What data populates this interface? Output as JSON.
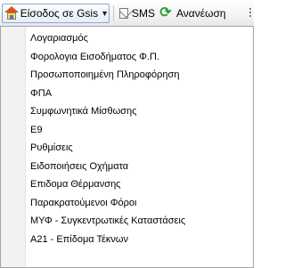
{
  "toolbar": {
    "gsis_label": "Είσοδος σε Gsis",
    "sms_label": "SMS",
    "refresh_label": "Ανανέωση"
  },
  "menu": {
    "items": [
      {
        "label": "Λογαριασμός"
      },
      {
        "label": "Φορολογια Εισοδήματος Φ.Π."
      },
      {
        "label": "Προσωποποιημένη Πληροφόρηση"
      },
      {
        "label": "ΦΠΑ"
      },
      {
        "label": "Συμφωνητικά Μίσθωσης"
      },
      {
        "label": "Ε9"
      },
      {
        "label": "Ρυθμίσεις"
      },
      {
        "label": "Ειδοποιήσεις  Οχήματα"
      },
      {
        "label": "Επιδομα Θέρμανσης"
      },
      {
        "label": "Παρακρατούμενοι Φόροι"
      },
      {
        "label": "ΜΥΦ - Συγκεντρωτικές Καταστάσεις"
      },
      {
        "label": "Α21 - Επίδομα Τέκνων"
      }
    ]
  },
  "icons": {
    "gsis": "house-icon",
    "dropdown": "chevron-down-icon",
    "sms": "envelope-icon",
    "refresh": "refresh-icon",
    "grip": "toolbar-grip-icon"
  }
}
